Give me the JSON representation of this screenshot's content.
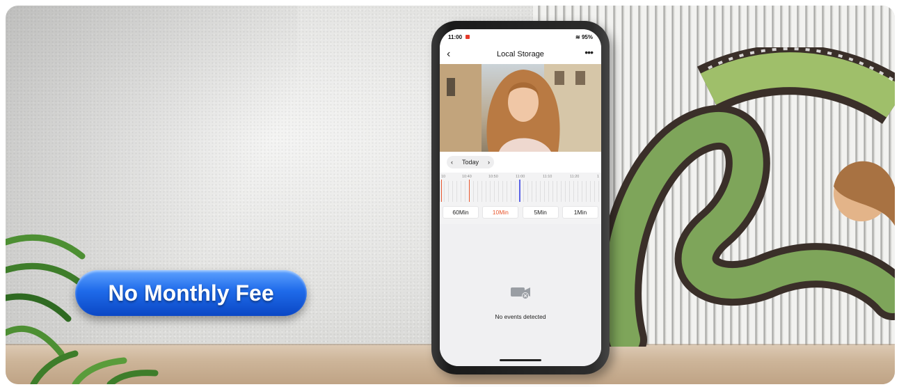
{
  "promo": {
    "headline": "No Monthly Fee"
  },
  "phone": {
    "status": {
      "time": "11:00",
      "battery": "95%"
    },
    "nav": {
      "title": "Local Storage",
      "back_glyph": "‹",
      "more_glyph": "•••"
    },
    "date": {
      "label": "Today",
      "prev_glyph": "‹",
      "next_glyph": "›"
    },
    "timeline": {
      "ticks": [
        "10",
        "10:40",
        "10:50",
        "11:00",
        "11:10",
        "11:20",
        "1"
      ]
    },
    "intervals": [
      {
        "label": "60Min",
        "active": false
      },
      {
        "label": "10Min",
        "active": true
      },
      {
        "label": "5Min",
        "active": false
      },
      {
        "label": "1Min",
        "active": false
      }
    ],
    "empty_state": {
      "message": "No events detected",
      "icon": "camera-off-icon"
    }
  },
  "colors": {
    "accent": "#e8562c",
    "pill_blue": "#1f6bea",
    "playhead": "#5b63e6"
  }
}
